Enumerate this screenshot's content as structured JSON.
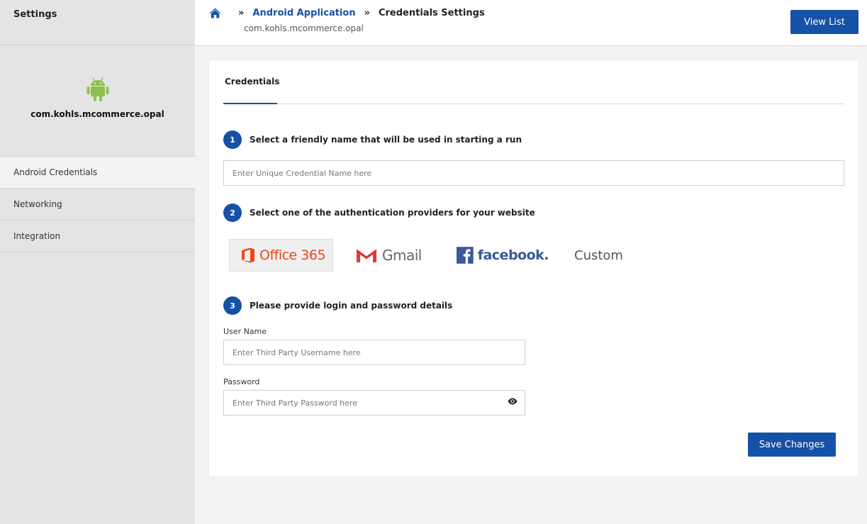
{
  "sidebar": {
    "title": "Settings",
    "app_name": "com.kohls.mcommerce.opal",
    "items": [
      {
        "label": "Android Credentials",
        "active": true
      },
      {
        "label": "Networking",
        "active": false
      },
      {
        "label": "Integration",
        "active": false
      }
    ]
  },
  "header": {
    "breadcrumb": {
      "parent": "Android Application",
      "separator": "»",
      "current": "Credentials Settings"
    },
    "subtitle": "com.kohls.mcommerce.opal",
    "view_list_label": "View List"
  },
  "main": {
    "tab_label": "Credentials",
    "steps": [
      {
        "number": "1",
        "text": "Select a friendly name that will be used in starting a run"
      },
      {
        "number": "2",
        "text": "Select one of the authentication providers for your website"
      },
      {
        "number": "3",
        "text": "Please provide login and password details"
      }
    ],
    "credential_name_placeholder": "Enter Unique Credential Name here",
    "providers": {
      "office": "Office 365",
      "gmail": "Gmail",
      "facebook": "facebook.",
      "custom": "Custom",
      "selected": "Office 365"
    },
    "username_label": "User Name",
    "username_placeholder": "Enter Third Party Username here",
    "password_label": "Password",
    "password_placeholder": "Enter Third Party Password here",
    "save_label": "Save Changes"
  },
  "colors": {
    "primary": "#1551a6",
    "android_green": "#8bc34a",
    "office_red": "#e64a19",
    "facebook_blue": "#3b5998"
  }
}
